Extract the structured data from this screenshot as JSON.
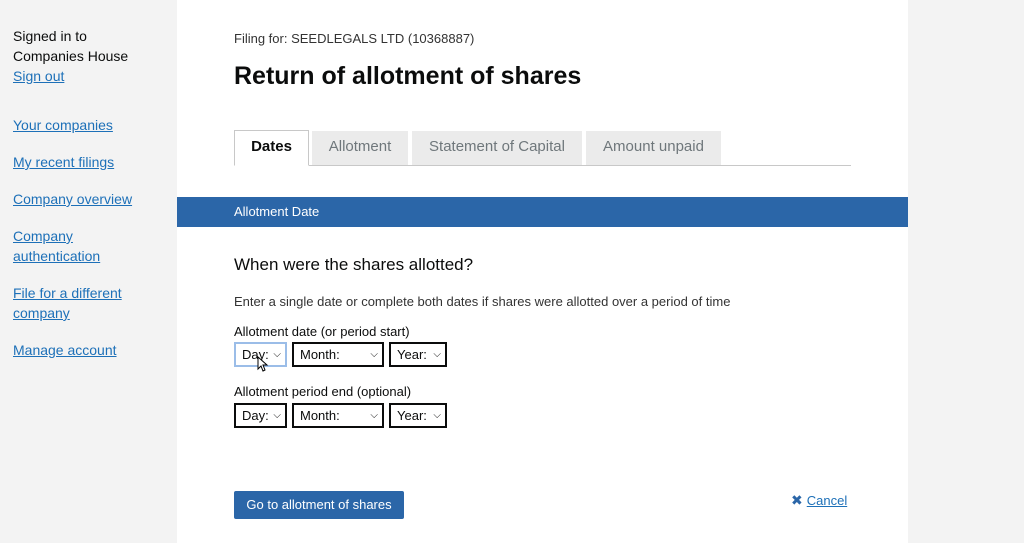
{
  "sidebar": {
    "signed_in_line1": "Signed in to",
    "signed_in_line2": "Companies House",
    "sign_out": "Sign out",
    "items": [
      {
        "label": "Your companies"
      },
      {
        "label": "My recent filings"
      },
      {
        "label": "Company overview"
      },
      {
        "label": "Company authentication"
      },
      {
        "label": "File for a different company"
      },
      {
        "label": "Manage account"
      }
    ]
  },
  "header": {
    "filing_for": "Filing for: SEEDLEGALS LTD (10368887)",
    "title": "Return of allotment of shares"
  },
  "tabs": [
    {
      "label": "Dates",
      "active": true
    },
    {
      "label": "Allotment",
      "active": false
    },
    {
      "label": "Statement of Capital",
      "active": false
    },
    {
      "label": "Amount unpaid",
      "active": false
    }
  ],
  "section": {
    "title": "Allotment Date",
    "question": "When were the shares allotted?",
    "hint": "Enter a single date or complete both dates if shares were allotted over a period of time"
  },
  "fields": {
    "start_label": "Allotment date (or period start)",
    "end_label": "Allotment period end (optional)",
    "day": "Day:",
    "month": "Month:",
    "year": "Year:"
  },
  "actions": {
    "primary": "Go to allotment of shares",
    "cancel": "Cancel"
  },
  "colors": {
    "accent": "#2b66a8",
    "link": "#1d70b8"
  }
}
